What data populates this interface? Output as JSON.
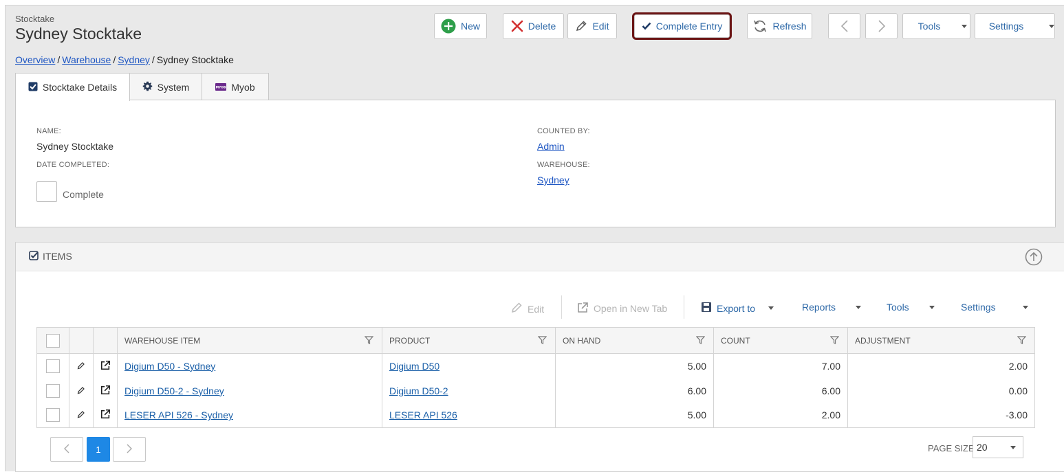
{
  "header": {
    "supertitle": "Stocktake",
    "title": "Sydney Stocktake"
  },
  "toolbar": {
    "new_label": "New",
    "delete_label": "Delete",
    "edit_label": "Edit",
    "complete_label": "Complete Entry",
    "refresh_label": "Refresh",
    "tools_label": "Tools",
    "settings_label": "Settings"
  },
  "breadcrumb": {
    "items": [
      "Overview",
      "Warehouse",
      "Sydney"
    ],
    "current": "Sydney Stocktake",
    "separator": "/"
  },
  "tabs": [
    {
      "label": "Stocktake Details"
    },
    {
      "label": "System"
    },
    {
      "label": "Myob"
    }
  ],
  "myob_logo_text": "MYOB",
  "details": {
    "name_label": "NAME:",
    "name_value": "Sydney Stocktake",
    "date_label": "DATE COMPLETED:",
    "complete_label": "Complete",
    "counted_label": "COUNTED BY:",
    "counted_value": "Admin",
    "warehouse_label": "WAREHOUSE:",
    "warehouse_value": "Sydney"
  },
  "items": {
    "title": "ITEMS",
    "toolbar": {
      "edit": "Edit",
      "open_tab": "Open in New Tab",
      "export": "Export to",
      "reports": "Reports",
      "tools": "Tools",
      "settings": "Settings"
    },
    "columns": [
      "WAREHOUSE ITEM",
      "PRODUCT",
      "ON HAND",
      "COUNT",
      "ADJUSTMENT"
    ],
    "rows": [
      {
        "item": "Digium D50 - Sydney",
        "product": "Digium D50",
        "on_hand": "5.00",
        "count": "7.00",
        "adjustment": "2.00"
      },
      {
        "item": "Digium D50-2 - Sydney",
        "product": "Digium D50-2",
        "on_hand": "6.00",
        "count": "6.00",
        "adjustment": "0.00"
      },
      {
        "item": "LESER API 526 - Sydney",
        "product": "LESER API 526",
        "on_hand": "5.00",
        "count": "2.00",
        "adjustment": "-3.00"
      }
    ],
    "pager": {
      "current_page": "1",
      "page_size_label": "PAGE SIZE",
      "page_size": "20"
    }
  },
  "colors": {
    "accent": "#2e69a8",
    "highlight_border": "#6b1515",
    "pager_active": "#1e88e5",
    "new_icon": "#2e9e4a",
    "delete_icon": "#d23030",
    "myob_logo": "#6b2a8c"
  }
}
